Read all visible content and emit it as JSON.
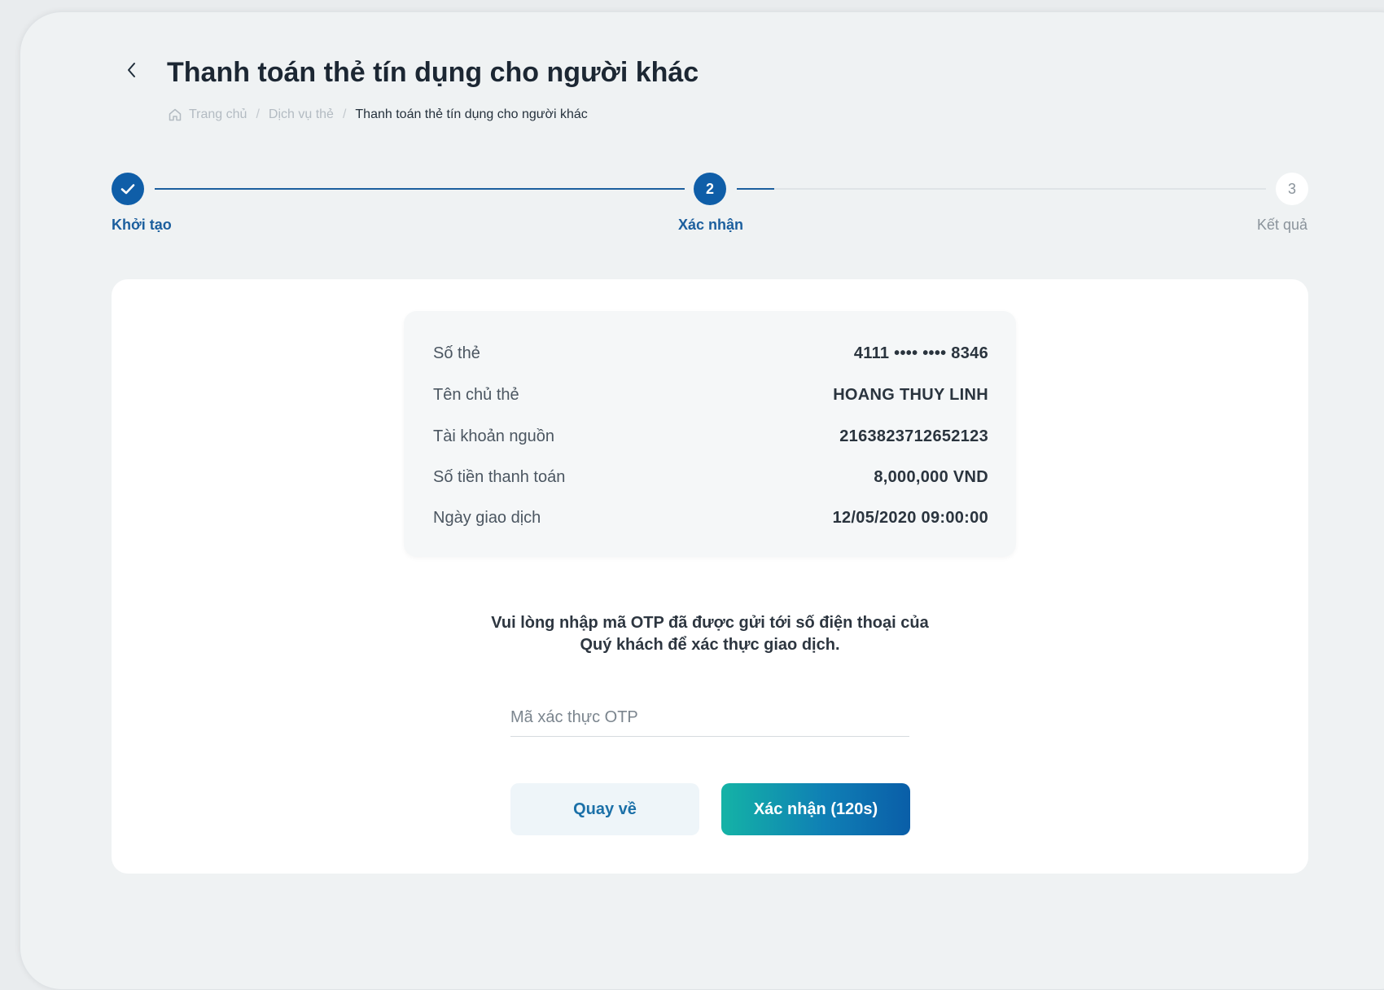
{
  "header": {
    "title": "Thanh toán thẻ tín dụng cho người khác"
  },
  "breadcrumb": {
    "items": [
      "Trang chủ",
      "Dịch vụ thẻ",
      "Thanh toán thẻ tín dụng cho người khác"
    ]
  },
  "stepper": {
    "steps": [
      {
        "number": "1",
        "label": "Khởi tạo",
        "state": "completed"
      },
      {
        "number": "2",
        "label": "Xác nhận",
        "state": "active"
      },
      {
        "number": "3",
        "label": "Kết quả",
        "state": "pending"
      }
    ]
  },
  "summary": {
    "rows": [
      {
        "label": "Số thẻ",
        "value": "4111 •••• •••• 8346"
      },
      {
        "label": "Tên chủ thẻ",
        "value": "HOANG THUY LINH"
      },
      {
        "label": "Tài khoản nguồn",
        "value": "2163823712652123"
      },
      {
        "label": "Số tiền thanh toán",
        "value": "8,000,000 VND"
      },
      {
        "label": "Ngày giao dịch",
        "value": "12/05/2020 09:00:00"
      }
    ]
  },
  "otp": {
    "instruction": "Vui lòng nhập mã OTP đã được gửi tới số điện thoại của Quý khách để xác thực giao dịch.",
    "placeholder": "Mã xác thực OTP",
    "value": ""
  },
  "actions": {
    "back_label": "Quay về",
    "confirm_label": "Xác nhận (120s)"
  },
  "colors": {
    "primary": "#0f5ea8",
    "accent_gradient_start": "#14b3a6",
    "accent_gradient_end": "#0a5ea8",
    "stepper_line_done": "#1c5f9e"
  }
}
